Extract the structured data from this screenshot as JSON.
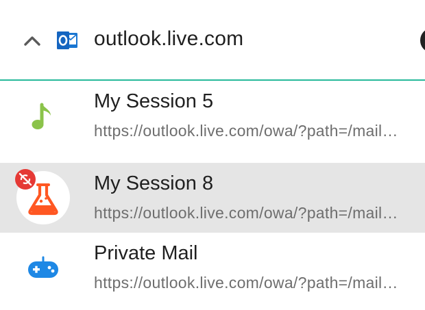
{
  "header": {
    "title": "outlook.live.com",
    "expand_icon": "chevron-up-icon",
    "site_icon": "outlook-icon"
  },
  "sessions": [
    {
      "title": "My Session 5",
      "url": "https://outlook.live.com/owa/?path=/mail/inbox",
      "icon": "music-note-icon",
      "icon_color": "#8bc34a",
      "selected": false
    },
    {
      "title": "My Session 8",
      "url": "https://outlook.live.com/owa/?path=/mail/inbox",
      "icon": "flask-icon",
      "icon_color": "#ff5722",
      "badge": "sync-disabled-icon",
      "badge_color": "#e53935",
      "selected": true
    },
    {
      "title": "Private Mail",
      "url": "https://outlook.live.com/owa/?path=/mail/inbox",
      "icon": "gamepad-icon",
      "icon_color": "#1e88e5",
      "selected": false
    }
  ],
  "colors": {
    "accent": "#26b99a",
    "selected_bg": "#e5e5e5",
    "text": "#1f1f1f",
    "subtext": "#6e6e6e"
  }
}
